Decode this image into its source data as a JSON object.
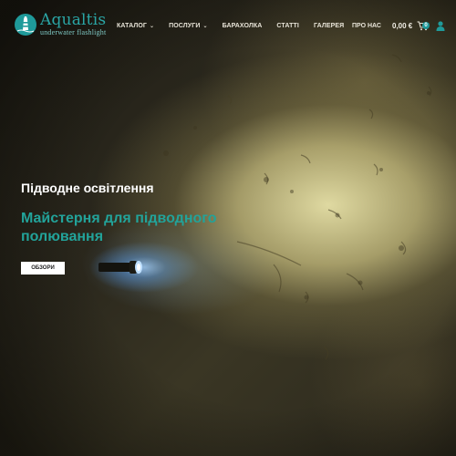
{
  "header": {
    "logo_name": "Aqualtis",
    "logo_tagline": "underwater flashlight",
    "nav": [
      {
        "label": "КАТАЛОГ",
        "has_dropdown": true
      },
      {
        "label": "ПОСЛУГИ",
        "has_dropdown": true
      },
      {
        "label": "БАРАХОЛКА",
        "has_dropdown": false
      },
      {
        "label": "СТАТТІ",
        "has_dropdown": false
      },
      {
        "label": "ГАЛЕРЕЯ",
        "has_dropdown": false
      }
    ],
    "about_label": "ПРО НАС",
    "cart_total": "0,00 €",
    "cart_count": "0",
    "icons": {
      "cart": "cart-icon",
      "user": "user-icon",
      "chevron": "chevron-down-icon",
      "logo": "lighthouse-logo-icon"
    }
  },
  "hero": {
    "title": "Підводне освітлення",
    "subtitle": "Майстерня для підводного полювання",
    "button_label": "ОБЗОРИ"
  },
  "colors": {
    "accent": "#1f9a9a",
    "subtitle": "#22a39a",
    "text_light": "#ffffff",
    "background": "#2a271c"
  }
}
